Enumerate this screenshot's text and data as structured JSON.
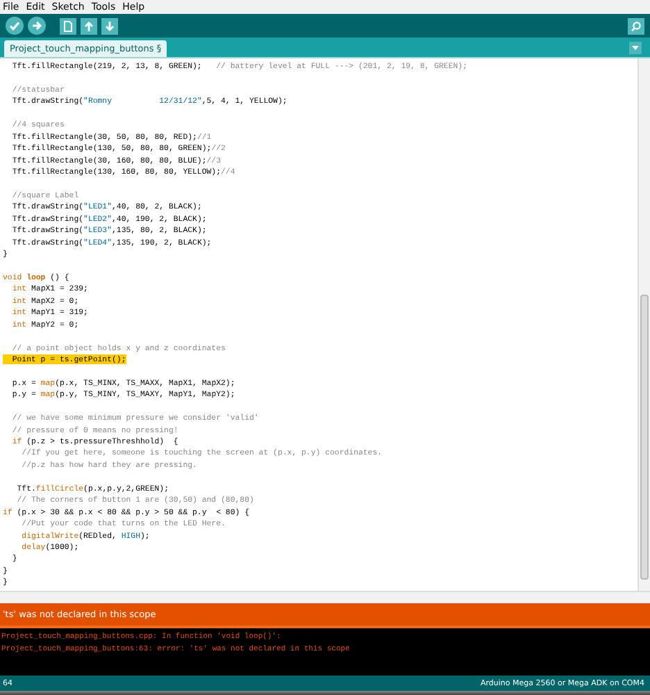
{
  "menu": [
    "File",
    "Edit",
    "Sketch",
    "Tools",
    "Help"
  ],
  "tab": {
    "label": "Project_touch_mapping_buttons §",
    "selected": true
  },
  "code": [
    {
      "segments": [
        {
          "kind": "plain",
          "text": "  Tft.fillRectangle(219, 2, 13, 8, GREEN);   "
        },
        {
          "kind": "comment",
          "text": "// battery level at FULL ---> (201, 2, 19, 8, GREEN);"
        }
      ]
    },
    {
      "blank_before": true,
      "segments": [
        {
          "kind": "comment",
          "text": "  //statusbar"
        }
      ]
    },
    {
      "segments": [
        {
          "kind": "plain",
          "text": "  Tft.drawString("
        },
        {
          "kind": "literal",
          "text": "\"Romny          12/31/12\""
        },
        {
          "kind": "plain",
          "text": ",5, 4, 1, YELLOW);"
        }
      ]
    },
    {
      "blank_before": true,
      "segments": [
        {
          "kind": "comment",
          "text": "  //4 squares"
        }
      ]
    },
    {
      "segments": [
        {
          "kind": "plain",
          "text": "  Tft.fillRectangle(30, 50, 80, 80, RED);"
        },
        {
          "kind": "comment",
          "text": "//1"
        }
      ]
    },
    {
      "segments": [
        {
          "kind": "plain",
          "text": "  Tft.fillRectangle(130, 50, 80, 80, GREEN);"
        },
        {
          "kind": "comment",
          "text": "//2"
        }
      ]
    },
    {
      "segments": [
        {
          "kind": "plain",
          "text": "  Tft.fillRectangle(30, 160, 80, 80, BLUE);"
        },
        {
          "kind": "comment",
          "text": "//3"
        }
      ]
    },
    {
      "segments": [
        {
          "kind": "plain",
          "text": "  Tft.fillRectangle(130, 160, 80, 80, YELLOW);"
        },
        {
          "kind": "comment",
          "text": "//4"
        }
      ]
    },
    {
      "blank_before": true,
      "segments": [
        {
          "kind": "comment",
          "text": "  //square Label"
        }
      ]
    },
    {
      "segments": [
        {
          "kind": "plain",
          "text": "  Tft.drawString("
        },
        {
          "kind": "literal",
          "text": "\"LED1\""
        },
        {
          "kind": "plain",
          "text": ",40, 80, 2, BLACK);"
        }
      ]
    },
    {
      "segments": [
        {
          "kind": "plain",
          "text": "  Tft.drawString("
        },
        {
          "kind": "literal",
          "text": "\"LED2\""
        },
        {
          "kind": "plain",
          "text": ",40, 190, 2, BLACK);"
        }
      ]
    },
    {
      "segments": [
        {
          "kind": "plain",
          "text": "  Tft.drawString("
        },
        {
          "kind": "literal",
          "text": "\"LED3\""
        },
        {
          "kind": "plain",
          "text": ",135, 80, 2, BLACK);"
        }
      ]
    },
    {
      "segments": [
        {
          "kind": "plain",
          "text": "  Tft.drawString("
        },
        {
          "kind": "literal",
          "text": "\"LED4\""
        },
        {
          "kind": "plain",
          "text": ",135, 190, 2, BLACK);"
        }
      ]
    },
    {
      "segments": [
        {
          "kind": "plain",
          "text": "}"
        }
      ]
    },
    {
      "blank_before": true,
      "segments": [
        {
          "kind": "keyword",
          "text": "void"
        },
        {
          "kind": "name",
          "text": " loop"
        },
        {
          "kind": "plain",
          "text": " () {"
        }
      ]
    },
    {
      "segments": [
        {
          "kind": "keyword",
          "text": "  int"
        },
        {
          "kind": "plain",
          "text": " MapX1 = 239;"
        }
      ]
    },
    {
      "segments": [
        {
          "kind": "keyword",
          "text": "  int"
        },
        {
          "kind": "plain",
          "text": " MapX2 = 0;"
        }
      ]
    },
    {
      "segments": [
        {
          "kind": "keyword",
          "text": "  int"
        },
        {
          "kind": "plain",
          "text": " MapY1 = 319;"
        }
      ]
    },
    {
      "segments": [
        {
          "kind": "keyword",
          "text": "  int"
        },
        {
          "kind": "plain",
          "text": " MapY2 = 0;"
        }
      ]
    },
    {
      "blank_before": true,
      "segments": [
        {
          "kind": "comment",
          "text": "  // a point object holds x y and z coordinates"
        }
      ]
    },
    {
      "highlighted": true,
      "segments": [
        {
          "kind": "plain",
          "text": "  Point p = ts.getPoint();"
        }
      ]
    },
    {
      "blank_before": true,
      "segments": [
        {
          "kind": "plain",
          "text": "  p.x = "
        },
        {
          "kind": "function",
          "text": "map"
        },
        {
          "kind": "plain",
          "text": "(p.x, TS_MINX, TS_MAXX, MapX1, MapX2);"
        }
      ]
    },
    {
      "segments": [
        {
          "kind": "plain",
          "text": "  p.y = "
        },
        {
          "kind": "function",
          "text": "map"
        },
        {
          "kind": "plain",
          "text": "(p.y, TS_MINY, TS_MAXY, MapY1, MapY2);"
        }
      ]
    },
    {
      "blank_before": true,
      "segments": [
        {
          "kind": "comment",
          "text": "  // we have some minimum pressure we consider 'valid'"
        }
      ]
    },
    {
      "segments": [
        {
          "kind": "comment",
          "text": "  // pressure of 0 means no pressing!"
        }
      ]
    },
    {
      "segments": [
        {
          "kind": "keyword",
          "text": "  if"
        },
        {
          "kind": "plain",
          "text": " (p.z > ts.pressureThreshhold)  {"
        }
      ]
    },
    {
      "segments": [
        {
          "kind": "comment",
          "text": "    //If you get here, someone is touching the screen at (p.x, p.y) coordinates."
        }
      ]
    },
    {
      "segments": [
        {
          "kind": "comment",
          "text": "    //p.z has how hard they are pressing."
        }
      ]
    },
    {
      "blank_before": true,
      "segments": [
        {
          "kind": "plain",
          "text": "   Tft."
        },
        {
          "kind": "function",
          "text": "fillCircle"
        },
        {
          "kind": "plain",
          "text": "(p.x,p.y,2,GREEN);"
        }
      ]
    },
    {
      "segments": [
        {
          "kind": "comment",
          "text": "   // The corners of button 1 are (30,50) and (80,80)"
        }
      ]
    },
    {
      "segments": [
        {
          "kind": "keyword",
          "text": "if"
        },
        {
          "kind": "plain",
          "text": " (p.x > 30 && p.x < 80 && p.y > 50 && p.y  < 80) {"
        }
      ]
    },
    {
      "segments": [
        {
          "kind": "comment",
          "text": "    //Put your code that turns on the LED Here."
        }
      ]
    },
    {
      "segments": [
        {
          "kind": "function",
          "text": "    digitalWrite"
        },
        {
          "kind": "plain",
          "text": "(REDled, "
        },
        {
          "kind": "literal",
          "text": "HIGH"
        },
        {
          "kind": "plain",
          "text": ");"
        }
      ]
    },
    {
      "segments": [
        {
          "kind": "function",
          "text": "    delay"
        },
        {
          "kind": "plain",
          "text": "(1000);"
        }
      ]
    },
    {
      "segments": [
        {
          "kind": "plain",
          "text": "  }"
        }
      ]
    },
    {
      "segments": [
        {
          "kind": "plain",
          "text": "}"
        }
      ]
    },
    {
      "segments": [
        {
          "kind": "plain",
          "text": "}"
        }
      ]
    }
  ],
  "error_bar": "'ts' was not declared in this scope",
  "console": [
    "Project_touch_mapping_buttons.cpp: In function 'void loop()':",
    "Project_touch_mapping_buttons:63: error: 'ts' was not declared in this scope"
  ],
  "status_bar": {
    "line": "64",
    "board": "Arduino Mega 2560 or Mega ADK on COM4"
  }
}
